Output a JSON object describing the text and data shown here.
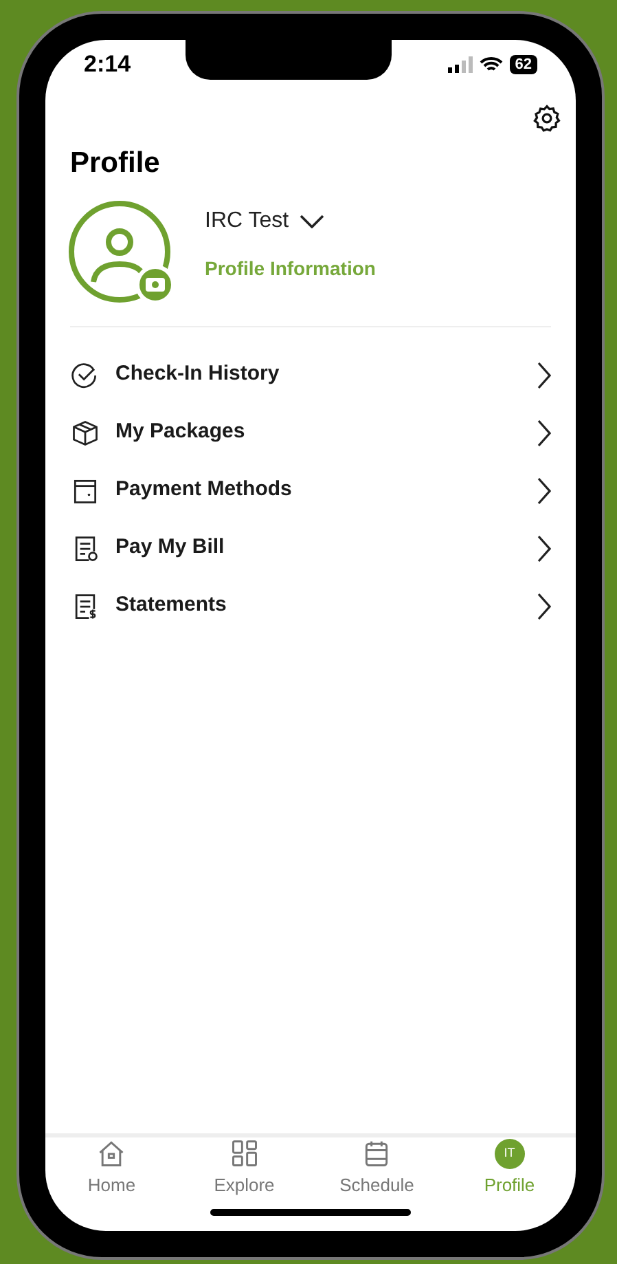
{
  "status_bar": {
    "time": "2:14",
    "battery": "62"
  },
  "title": "Profile",
  "profile": {
    "name": "IRC Test",
    "link": "Profile Information"
  },
  "menu": [
    {
      "kind": "checkin",
      "label": "Check-In History"
    },
    {
      "kind": "package",
      "label": "My Packages"
    },
    {
      "kind": "wallet",
      "label": "Payment Methods"
    },
    {
      "kind": "bill",
      "label": "Pay My Bill"
    },
    {
      "kind": "statement",
      "label": "Statements"
    }
  ],
  "tabs": [
    {
      "kind": "home",
      "label": "Home",
      "selected": false
    },
    {
      "kind": "explore",
      "label": "Explore",
      "selected": false
    },
    {
      "kind": "schedule",
      "label": "Schedule",
      "selected": false
    },
    {
      "kind": "avatar",
      "label": "Profile",
      "initials": "IT",
      "selected": true
    }
  ]
}
